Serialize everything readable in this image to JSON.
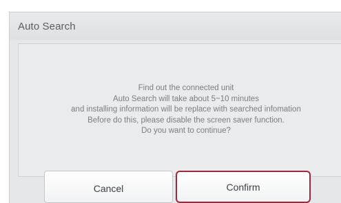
{
  "dialog": {
    "title": "Auto Search",
    "message_lines": [
      "Find out the connected unit",
      "Auto Search will take about 5~10 minutes",
      "and installing information will be replace with searched infomation",
      "Before do this, please disable the screen saver function.",
      "Do you want to continue?"
    ],
    "buttons": {
      "cancel_label": "Cancel",
      "confirm_label": "Confirm"
    },
    "colors": {
      "confirm_focus_border": "#a1253b",
      "panel_background": "#e6e7e8",
      "text": "#7a7d80"
    }
  }
}
